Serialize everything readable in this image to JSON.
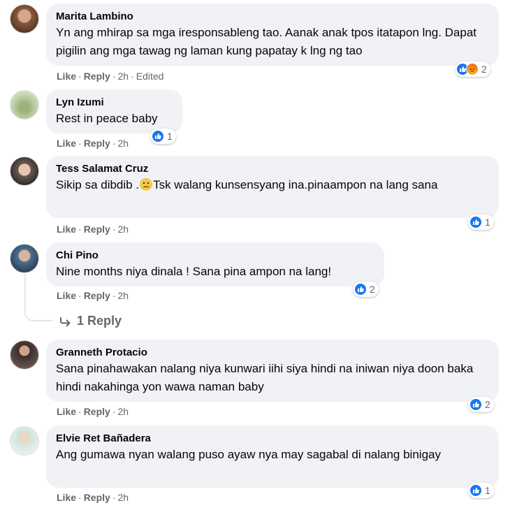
{
  "actions": {
    "like": "Like",
    "reply": "Reply",
    "sep": "·"
  },
  "comments": [
    {
      "author": "Marita Lambino",
      "text": "Yn ang mhirap sa mga iresponsableng tao. Aanak anak tpos itatapon lng. Dapat pigilin ang mga tawag ng laman kung papatay k lng ng tao",
      "time": "2h",
      "edited": "Edited",
      "reactions": "2",
      "reaction_icons": [
        "like-icon",
        "angry-icon"
      ]
    },
    {
      "author": "Lyn Izumi",
      "text": "Rest in peace baby",
      "time": "2h",
      "reactions": "1"
    },
    {
      "author": "Tess Salamat Cruz",
      "text_before": "Sikip sa dibdib .",
      "text_after": "Tsk walang kunsensyang ina.pinaampon na lang sana",
      "time": "2h",
      "reactions": "1"
    },
    {
      "author": "Chi Pino",
      "text": "Nine months niya dinala ! Sana pina ampon na lang!",
      "time": "2h",
      "reactions": "2",
      "replies_label": "1 Reply"
    },
    {
      "author": "Granneth Protacio",
      "text": "Sana pinahawakan nalang niya kunwari iihi siya hindi na iniwan niya doon baka hindi nakahinga yon wawa naman baby",
      "time": "2h",
      "reactions": "2"
    },
    {
      "author": "Elvie Ret Bañadera",
      "text": "Ang gumawa nyan walang puso ayaw nya may sagabal di nalang binigay",
      "time": "2h",
      "reactions": "1"
    }
  ],
  "colors": {
    "like_blue": "#1877f2",
    "bubble_bg": "#f0f2f5",
    "meta_gray": "#65676b"
  }
}
